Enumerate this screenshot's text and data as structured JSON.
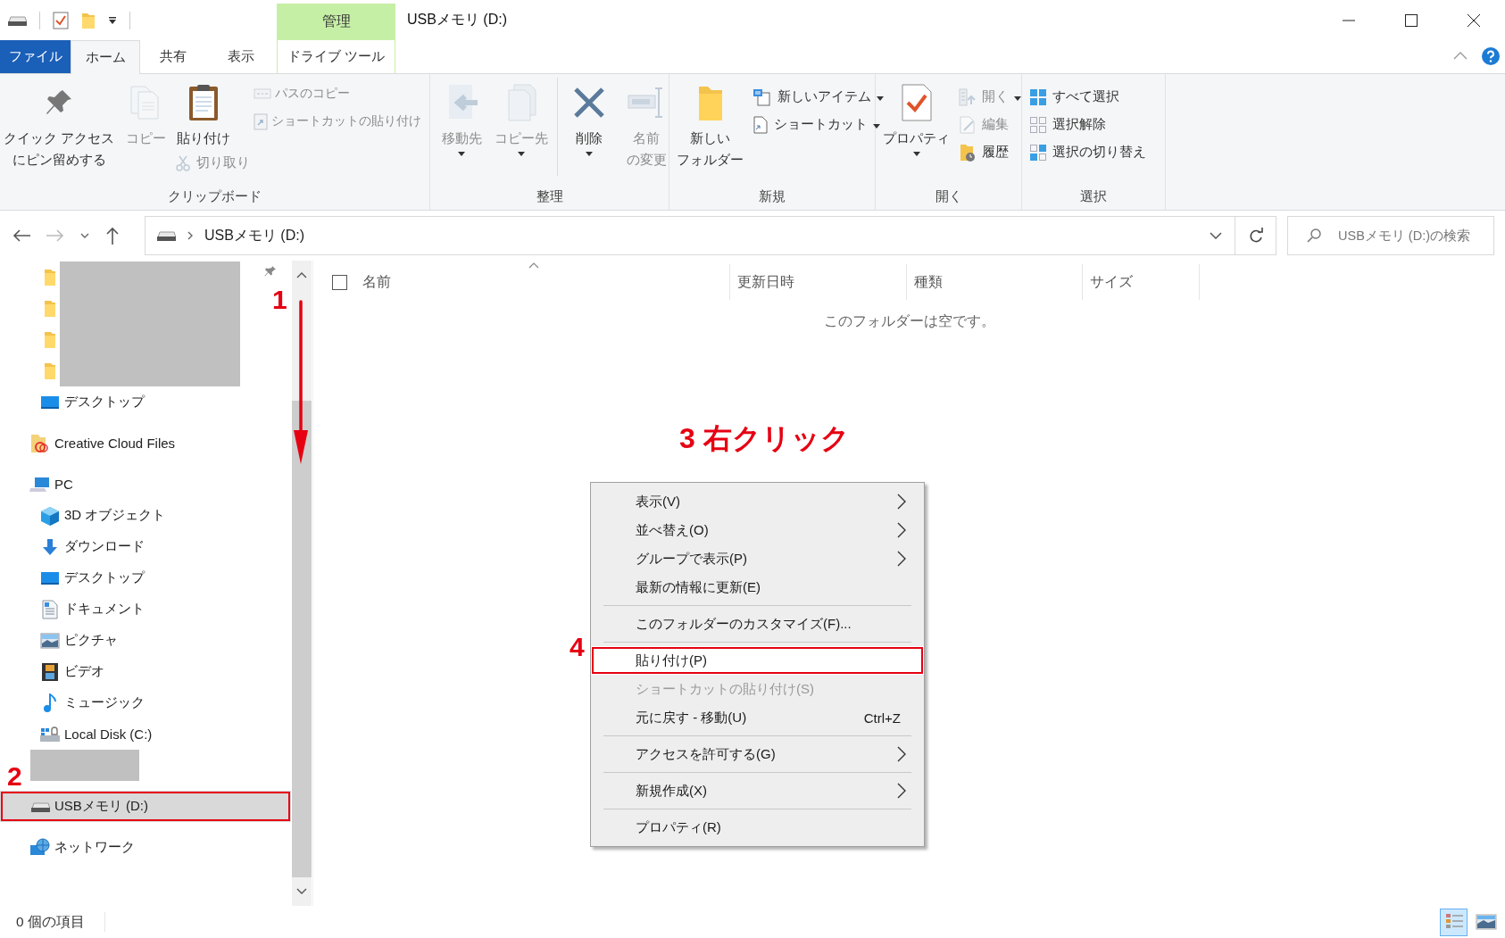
{
  "title_bar": {
    "title": "USBメモリ (D:)"
  },
  "ribbon": {
    "tabs": [
      {
        "label": "ファイル",
        "kind": "file",
        "selected": false
      },
      {
        "label": "ホーム",
        "kind": "tab",
        "selected": true
      },
      {
        "label": "共有",
        "kind": "tab",
        "selected": false
      },
      {
        "label": "表示",
        "kind": "tab",
        "selected": false
      },
      {
        "label": "ドライブ ツール",
        "kind": "tab",
        "selected": false,
        "context_group": "管理"
      }
    ],
    "groups": [
      {
        "label": "クリップボード",
        "columns": [
          [
            {
              "lines": [
                "クイック アクセス",
                "にピン留めする"
              ],
              "kind": "large",
              "disabled": false,
              "dropdown": false
            }
          ],
          [
            {
              "label": "コピー",
              "kind": "large",
              "disabled": true,
              "dropdown": false
            }
          ],
          [
            {
              "label": "貼り付け",
              "kind": "large",
              "disabled": false,
              "dropdown": false
            },
            {
              "label": "切り取り",
              "kind": "small",
              "disabled": true,
              "dropdown": false
            }
          ],
          [
            {
              "label": "パスのコピー",
              "kind": "small",
              "disabled": true,
              "dropdown": false
            },
            {
              "label": "ショートカットの貼り付け",
              "kind": "small",
              "disabled": true,
              "dropdown": false
            }
          ]
        ]
      },
      {
        "label": "整理",
        "columns": [
          [
            {
              "label": "移動先",
              "kind": "large",
              "disabled": true,
              "dropdown": true
            }
          ],
          [
            {
              "label": "コピー先",
              "kind": "large",
              "disabled": true,
              "dropdown": true
            }
          ],
          [
            {
              "label": "削除",
              "kind": "large",
              "disabled": false,
              "dropdown": true
            }
          ],
          [
            {
              "lines": [
                "名前",
                "の変更"
              ],
              "kind": "large",
              "disabled": true,
              "dropdown": false
            }
          ]
        ]
      },
      {
        "label": "新規",
        "columns": [
          [
            {
              "lines": [
                "新しい",
                "フォルダー"
              ],
              "kind": "large",
              "disabled": false,
              "dropdown": false
            }
          ],
          [
            {
              "label": "新しいアイテム",
              "kind": "small",
              "disabled": false,
              "dropdown": true
            },
            {
              "label": "ショートカット",
              "kind": "small",
              "disabled": false,
              "dropdown": true
            }
          ]
        ]
      },
      {
        "label": "開く",
        "columns": [
          [
            {
              "label": "プロパティ",
              "kind": "large",
              "disabled": false,
              "dropdown": true
            }
          ],
          [
            {
              "label": "開く",
              "kind": "small",
              "disabled": true,
              "dropdown": true
            },
            {
              "label": "編集",
              "kind": "small",
              "disabled": true,
              "dropdown": false
            },
            {
              "label": "履歴",
              "kind": "small",
              "disabled": false,
              "dropdown": false
            }
          ]
        ]
      },
      {
        "label": "選択",
        "columns": [
          [
            {
              "label": "すべて選択",
              "kind": "small",
              "disabled": false,
              "dropdown": false
            },
            {
              "label": "選択解除",
              "kind": "small",
              "disabled": false,
              "dropdown": false
            },
            {
              "label": "選択の切り替え",
              "kind": "small",
              "disabled": false,
              "dropdown": false
            }
          ]
        ]
      }
    ]
  },
  "address_bar": {
    "path": [
      {
        "label": "USBメモリ (D:)"
      }
    ],
    "search": {
      "placeholder": "USBメモリ (D:)の検索"
    }
  },
  "navigation_pane": {
    "scroll_step": "1",
    "quick_access_items": [
      {
        "kind": "folder",
        "redacted": true,
        "pin_shown": true
      },
      {
        "kind": "folder",
        "redacted": true,
        "pin_shown": false
      },
      {
        "kind": "folder",
        "redacted": true,
        "pin_shown": false
      },
      {
        "kind": "folder",
        "redacted": true,
        "pin_shown": false
      },
      {
        "kind": "desktop",
        "label": "デスクトップ",
        "redacted": false,
        "pin_shown": false
      }
    ],
    "items": [
      {
        "kind": "cloud",
        "label": "Creative Cloud Files",
        "selected": false
      },
      {
        "kind": "pc",
        "label": "PC",
        "selected": false,
        "children": [
          {
            "kind": "cube",
            "label": "3D オブジェクト",
            "redacted": false
          },
          {
            "kind": "download",
            "label": "ダウンロード",
            "redacted": false
          },
          {
            "kind": "desktop",
            "label": "デスクトップ",
            "redacted": false
          },
          {
            "kind": "document",
            "label": "ドキュメント",
            "redacted": false
          },
          {
            "kind": "picture",
            "label": "ピクチャ",
            "redacted": false
          },
          {
            "kind": "video",
            "label": "ビデオ",
            "redacted": false
          },
          {
            "kind": "music",
            "label": "ミュージック",
            "redacted": false
          },
          {
            "kind": "disk",
            "label": "Local Disk (C:)",
            "redacted": false
          },
          {
            "kind": "disk",
            "redacted": true
          }
        ]
      },
      {
        "kind": "usb",
        "label": "USBメモリ (D:)",
        "selected": true,
        "step": "2"
      },
      {
        "kind": "network",
        "label": "ネットワーク",
        "selected": false
      }
    ]
  },
  "file_list": {
    "select_all_checked": false,
    "columns": [
      {
        "label": "名前",
        "sorted": true
      },
      {
        "label": "更新日時",
        "sorted": false
      },
      {
        "label": "種類",
        "sorted": false
      },
      {
        "label": "サイズ",
        "sorted": false
      }
    ],
    "empty_message": "このフォルダーは空です。",
    "step": "3 右クリック"
  },
  "context_menu": {
    "items": [
      {
        "kind": "item",
        "label": "表示(V)",
        "submenu": true,
        "disabled": false,
        "hovered": false
      },
      {
        "kind": "item",
        "label": "並べ替え(O)",
        "submenu": true,
        "disabled": false,
        "hovered": false
      },
      {
        "kind": "item",
        "label": "グループで表示(P)",
        "submenu": true,
        "disabled": false,
        "hovered": false
      },
      {
        "kind": "item",
        "label": "最新の情報に更新(E)",
        "submenu": false,
        "disabled": false,
        "hovered": false
      },
      {
        "kind": "separator"
      },
      {
        "kind": "item",
        "label": "このフォルダーのカスタマイズ(F)...",
        "submenu": false,
        "disabled": false,
        "hovered": false
      },
      {
        "kind": "separator"
      },
      {
        "kind": "item",
        "label": "貼り付け(P)",
        "submenu": false,
        "disabled": false,
        "hovered": true,
        "step": "4"
      },
      {
        "kind": "item",
        "label": "ショートカットの貼り付け(S)",
        "submenu": false,
        "disabled": true,
        "hovered": false
      },
      {
        "kind": "item",
        "label": "元に戻す - 移動(U)",
        "shortcut": "Ctrl+Z",
        "submenu": false,
        "disabled": false,
        "hovered": false
      },
      {
        "kind": "separator"
      },
      {
        "kind": "item",
        "label": "アクセスを許可する(G)",
        "submenu": true,
        "disabled": false,
        "hovered": false
      },
      {
        "kind": "separator"
      },
      {
        "kind": "item",
        "label": "新規作成(X)",
        "submenu": true,
        "disabled": false,
        "hovered": false
      },
      {
        "kind": "separator"
      },
      {
        "kind": "item",
        "label": "プロパティ(R)",
        "submenu": false,
        "disabled": false,
        "hovered": false
      }
    ]
  },
  "status_bar": {
    "item_count": "0 個の項目",
    "views": [
      {
        "kind": "details",
        "selected": true
      },
      {
        "kind": "large_icons",
        "selected": false
      }
    ]
  }
}
